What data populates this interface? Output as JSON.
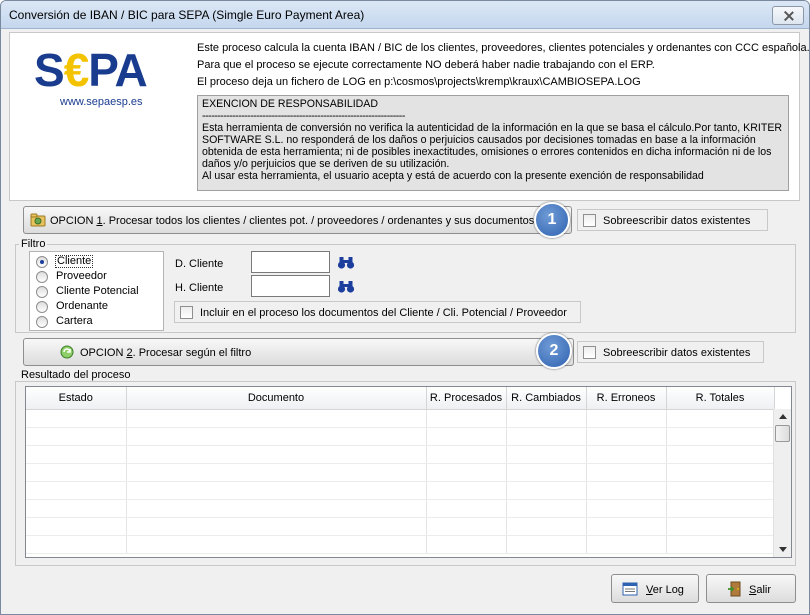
{
  "window": {
    "title": "Conversión de IBAN / BIC para SEPA (Simgle Euro Payment Area)"
  },
  "info": {
    "logo_text_before": "S",
    "logo_text_euro": "€",
    "logo_text_after": "PA",
    "logo_url": "www.sepaesp.es",
    "line1": "Este proceso calcula la cuenta IBAN / BIC de los clientes, proveedores, clientes potenciales y ordenantes con CCC española.",
    "line2": "Para que el proceso se ejecute correctamente NO deberá haber nadie trabajando con el ERP.",
    "line3": "El proceso deja un fichero de LOG en p:\\cosmos\\projects\\kremp\\kraux\\CAMBIOSEPA.LOG",
    "disclaimer_title": "EXENCION DE RESPONSABILIDAD",
    "disclaimer_separator": "-------------------------------------------------------------------",
    "disclaimer_lines": [
      "Esta herramienta de conversión no verifica la autenticidad de la información en la que se basa el cálculo.Por tanto, KRITER",
      "SOFTWARE S.L. no responderá de los daños o perjuicios causados por decisiones tomadas en base a la información",
      "obtenida de esta herramienta; ni de posibles inexactitudes, omisiones o errores contenidos en dicha información ni de los",
      "daños y/o perjuicios que se deriven de su utilización.",
      "Al usar esta herramienta, el usuario acepta y está de acuerdo con la presente exención de responsabilidad"
    ]
  },
  "option1": {
    "prefix": "OPCION ",
    "number": "1",
    "label": ". Procesar todos los clientes / clientes pot. / proveedores / ordenantes y sus documentos",
    "badge": "1",
    "overwrite_label": "Sobreescribir datos existentes",
    "overwrite_checked": false
  },
  "filter": {
    "title": "Filtro",
    "radios": [
      {
        "label": "Cliente",
        "checked": true
      },
      {
        "label": "Proveedor",
        "checked": false
      },
      {
        "label": "Cliente Potencial",
        "checked": false
      },
      {
        "label": "Ordenante",
        "checked": false
      },
      {
        "label": "Cartera",
        "checked": false
      }
    ],
    "from_label": "D. Cliente",
    "from_value": "",
    "to_label": "H. Cliente",
    "to_value": "",
    "include_docs_label": "Incluir en el proceso los documentos del Cliente / Cli. Potencial / Proveedor",
    "include_docs_checked": false
  },
  "option2": {
    "prefix": "OPCION ",
    "number": "2",
    "label": ". Procesar según el filtro",
    "badge": "2",
    "overwrite_label": "Sobreescribir datos existentes",
    "overwrite_checked": false
  },
  "results": {
    "title": "Resultado del proceso",
    "columns": [
      "Estado",
      "Documento",
      "R. Procesados",
      "R. Cambiados",
      "R. Erroneos",
      "R. Totales"
    ]
  },
  "footer": {
    "view_log_underlined": "V",
    "view_log_rest": "er Log",
    "exit_underlined": "S",
    "exit_rest": "alir"
  },
  "colors": {
    "sepa_blue": "#1a3c8f",
    "sepa_yellow": "#f4c300",
    "badge_blue": "#2f62b0"
  }
}
